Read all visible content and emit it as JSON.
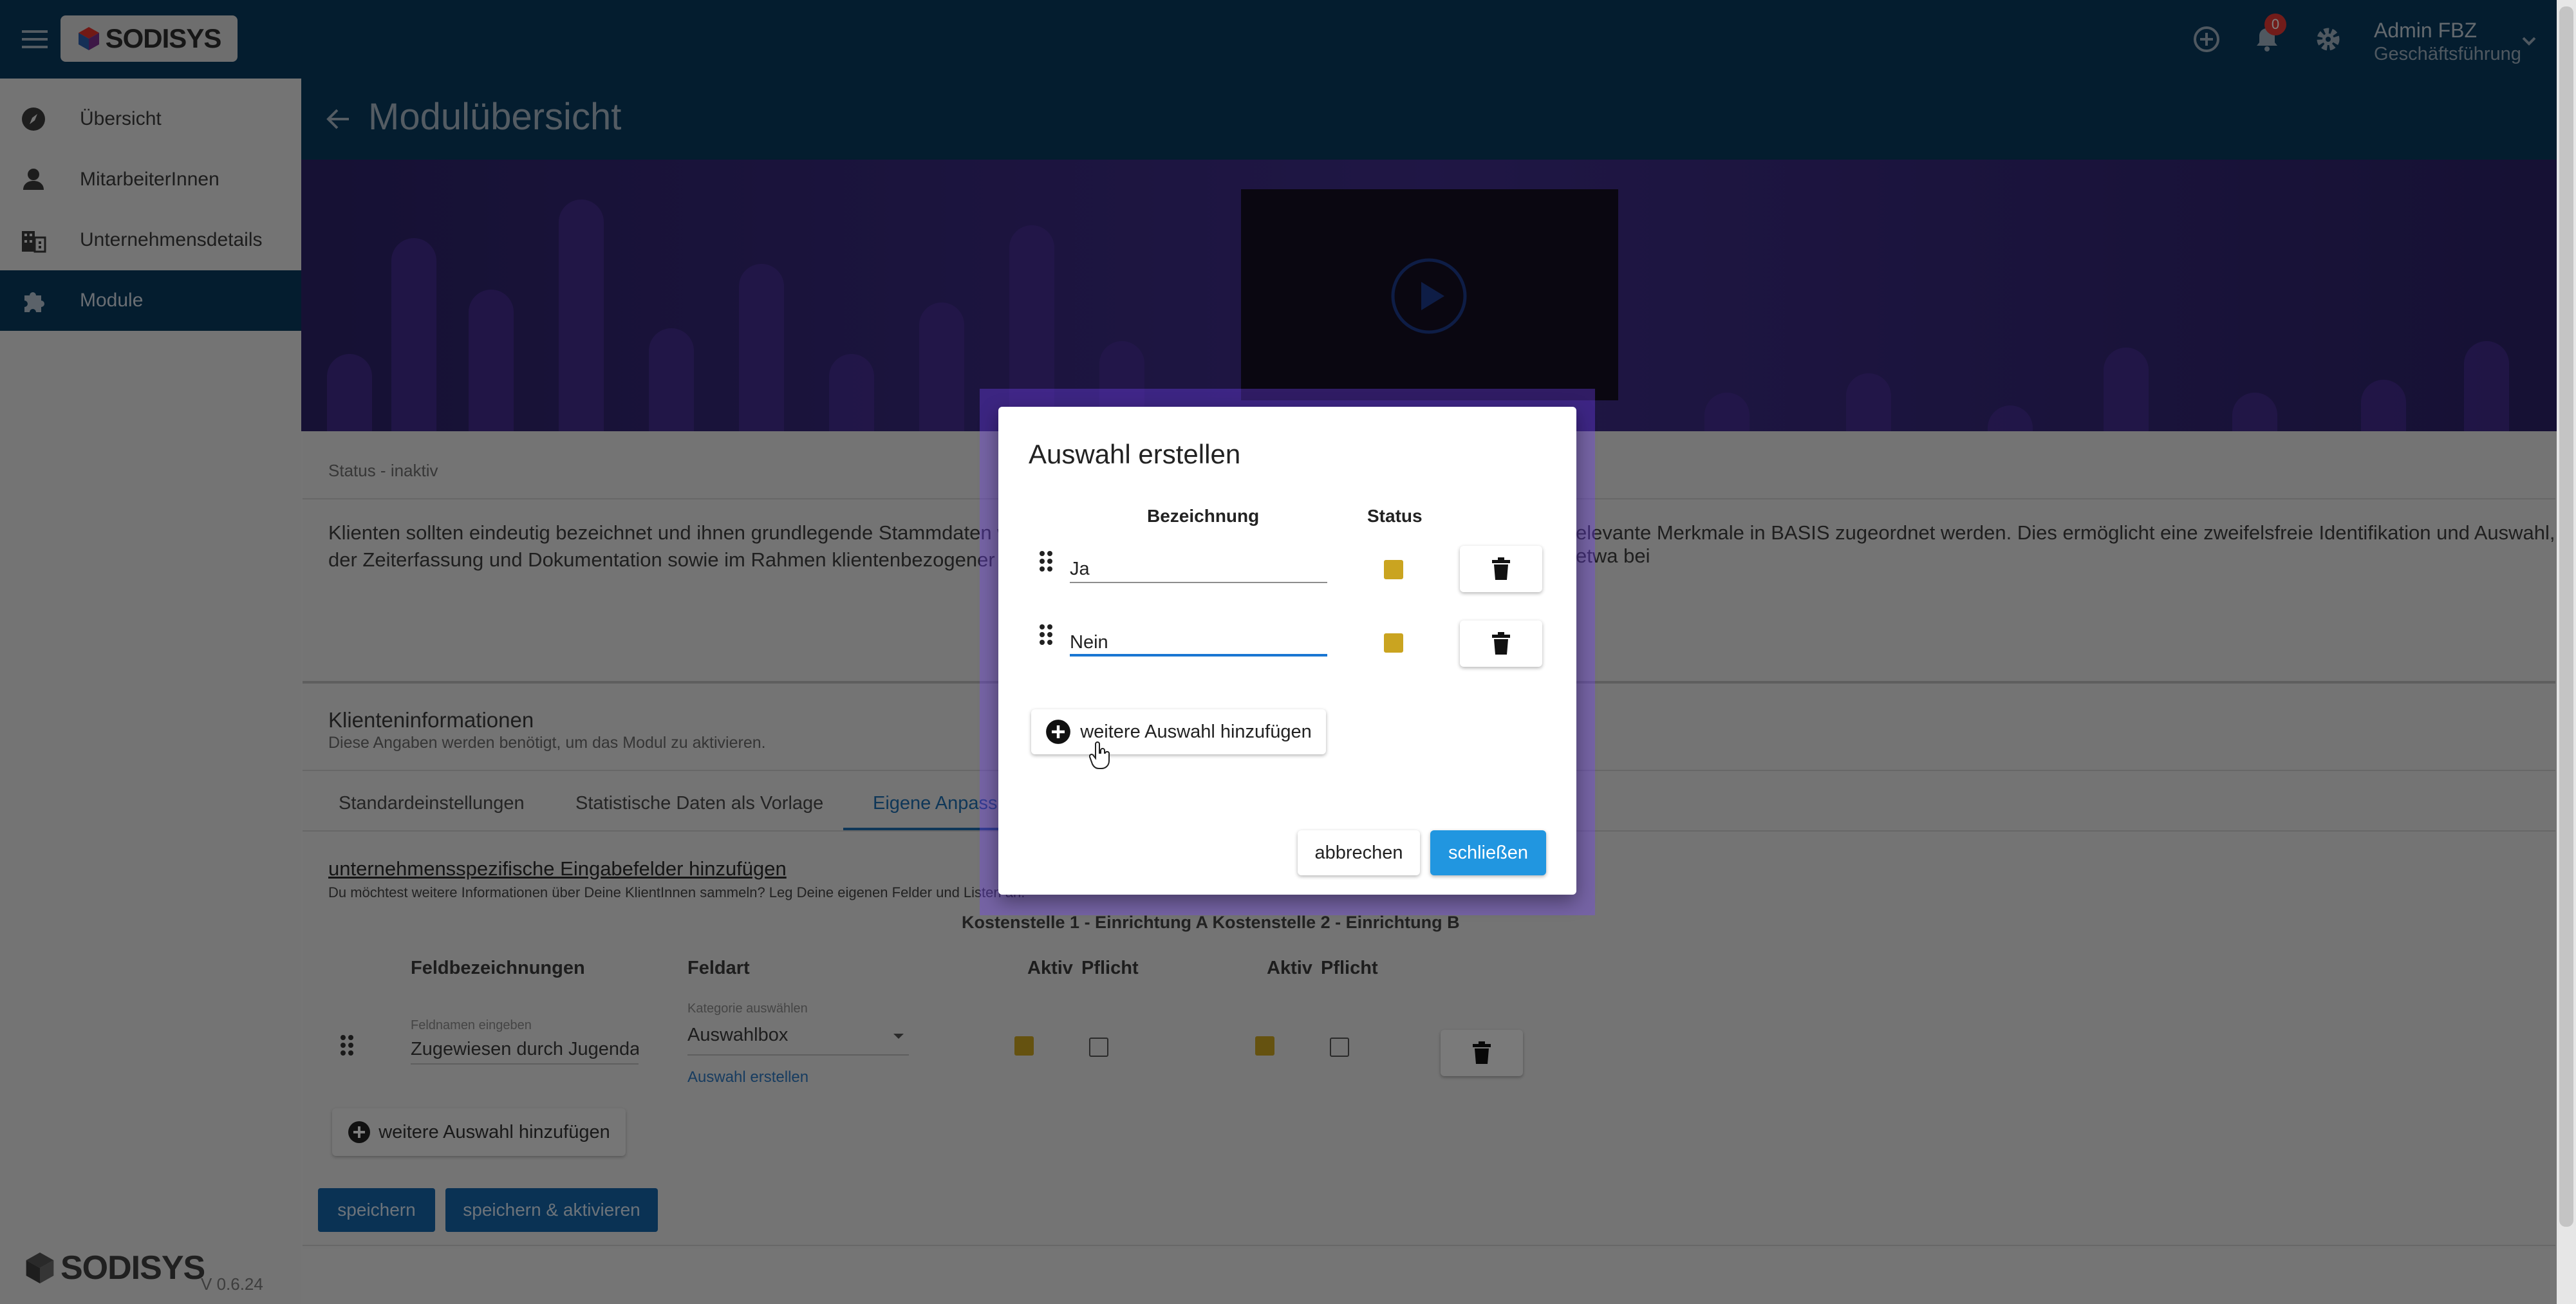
{
  "app": {
    "logo_text": "SODISYS",
    "version": "V 0.6.24",
    "notification_count": "0",
    "user": {
      "name": "Admin FBZ",
      "role": "Geschäftsführung"
    }
  },
  "sidebar": {
    "items": [
      {
        "label": "Übersicht",
        "icon": "compass-icon"
      },
      {
        "label": "MitarbeiterInnen",
        "icon": "person-icon"
      },
      {
        "label": "Unternehmensdetails",
        "icon": "building-icon"
      },
      {
        "label": "Module",
        "icon": "puzzle-icon",
        "active": true
      }
    ]
  },
  "page": {
    "title": "Modulübersicht",
    "status": "Status - inaktiv",
    "description_left": "Klienten sollten eindeutig bezeichnet und ihnen grundlegende Stammdaten wie Kontak",
    "description_right": "elevante Merkmale in BASIS zugeordnet werden. Dies ermöglicht eine zweifelsfreie Identifikation und Auswahl, etwa bei",
    "description_line2": "der Zeiterfassung und Dokumentation sowie im Rahmen klientenbezogener Auswertur",
    "section_title": "Klienteninformationen",
    "section_subtitle": "Diese Angaben werden benötigt, um das Modul zu aktivieren.",
    "tabs": [
      "Standardeinstellungen",
      "Statistische Daten als Vorlage",
      "Eigene Anpassu"
    ],
    "custom_fields_link": "unternehmensspezifische Eingabefelder hinzufügen",
    "custom_fields_hint": "Du möchtest weitere Informationen über Deine KlientInnen sammeln? Leg Deine eigenen Felder und Listen an.",
    "cost_centers": "Kostenstelle 1 - Einrichtung A Kostenstelle 2 - Einrichtung B",
    "columns": {
      "name": "Feldbezeichnungen",
      "type": "Feldart",
      "active": "Aktiv",
      "required": "Pflicht"
    },
    "row": {
      "name_label": "Feldnamen eingeben",
      "name_value": "Zugewiesen durch Jugendam",
      "type_label": "Kategorie auswählen",
      "type_value": "Auswahlbox",
      "create_link": "Auswahl erstellen"
    },
    "add_more": "weitere Auswahl hinzufügen",
    "save": "speichern",
    "save_activate": "speichern & aktivieren"
  },
  "dialog": {
    "title": "Auswahl erstellen",
    "col_name": "Bezeichnung",
    "col_status": "Status",
    "options": [
      {
        "value": "Ja",
        "status": true
      },
      {
        "value": "Nein",
        "status": true
      }
    ],
    "add_more": "weitere Auswahl hinzufügen",
    "cancel": "abbrechen",
    "close": "schließen"
  },
  "colors": {
    "topbar": "#083a5f",
    "accent_blue": "#2196e0",
    "checkbox_yellow": "#caa420"
  }
}
